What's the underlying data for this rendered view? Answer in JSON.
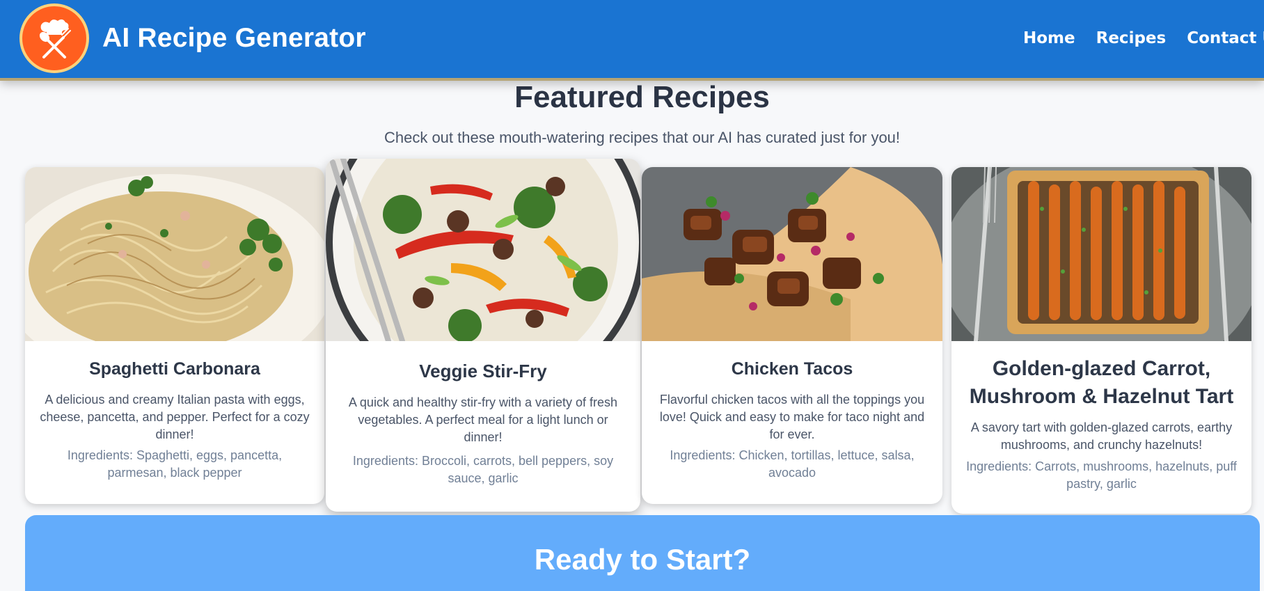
{
  "header": {
    "brand": "AI Recipe Generator",
    "logo_icon": "chef-hat-utensils-icon",
    "nav": [
      "Home",
      "Recipes",
      "Contact Us"
    ]
  },
  "featured": {
    "title": "Featured Recipes",
    "subtitle": "Check out these mouth-watering recipes that our AI has curated just for you!",
    "recipes": [
      {
        "title": "Spaghetti Carbonara",
        "description": "A delicious and creamy Italian pasta with eggs, cheese, pancetta, and pepper. Perfect for a cozy dinner!",
        "ingredients": "Ingredients: Spaghetti, eggs, pancetta, parmesan, black pepper"
      },
      {
        "title": "Veggie Stir-Fry",
        "description": "A quick and healthy stir-fry with a variety of fresh vegetables. A perfect meal for a light lunch or dinner!",
        "ingredients": "Ingredients: Broccoli, carrots, bell peppers, soy sauce, garlic"
      },
      {
        "title": "Chicken Tacos",
        "description": "Flavorful chicken tacos with all the toppings you love! Quick and easy to make for taco night and for ever.",
        "ingredients": "Ingredients: Chicken, tortillas, lettuce, salsa, avocado"
      },
      {
        "title": "Golden-glazed Carrot, Mushroom & Hazelnut Tart",
        "description": "A savory tart with golden-glazed carrots, earthy mushrooms, and crunchy hazelnuts!",
        "ingredients": "Ingredients: Carrots, mushrooms, hazelnuts, puff pastry, garlic"
      }
    ]
  },
  "cta": {
    "title": "Ready to Start?"
  },
  "colors": {
    "header_bg": "#1a74d2",
    "logo_bg": "#ff5f1f",
    "cta_bg": "#63acfb",
    "heading_text": "#2b3445"
  }
}
